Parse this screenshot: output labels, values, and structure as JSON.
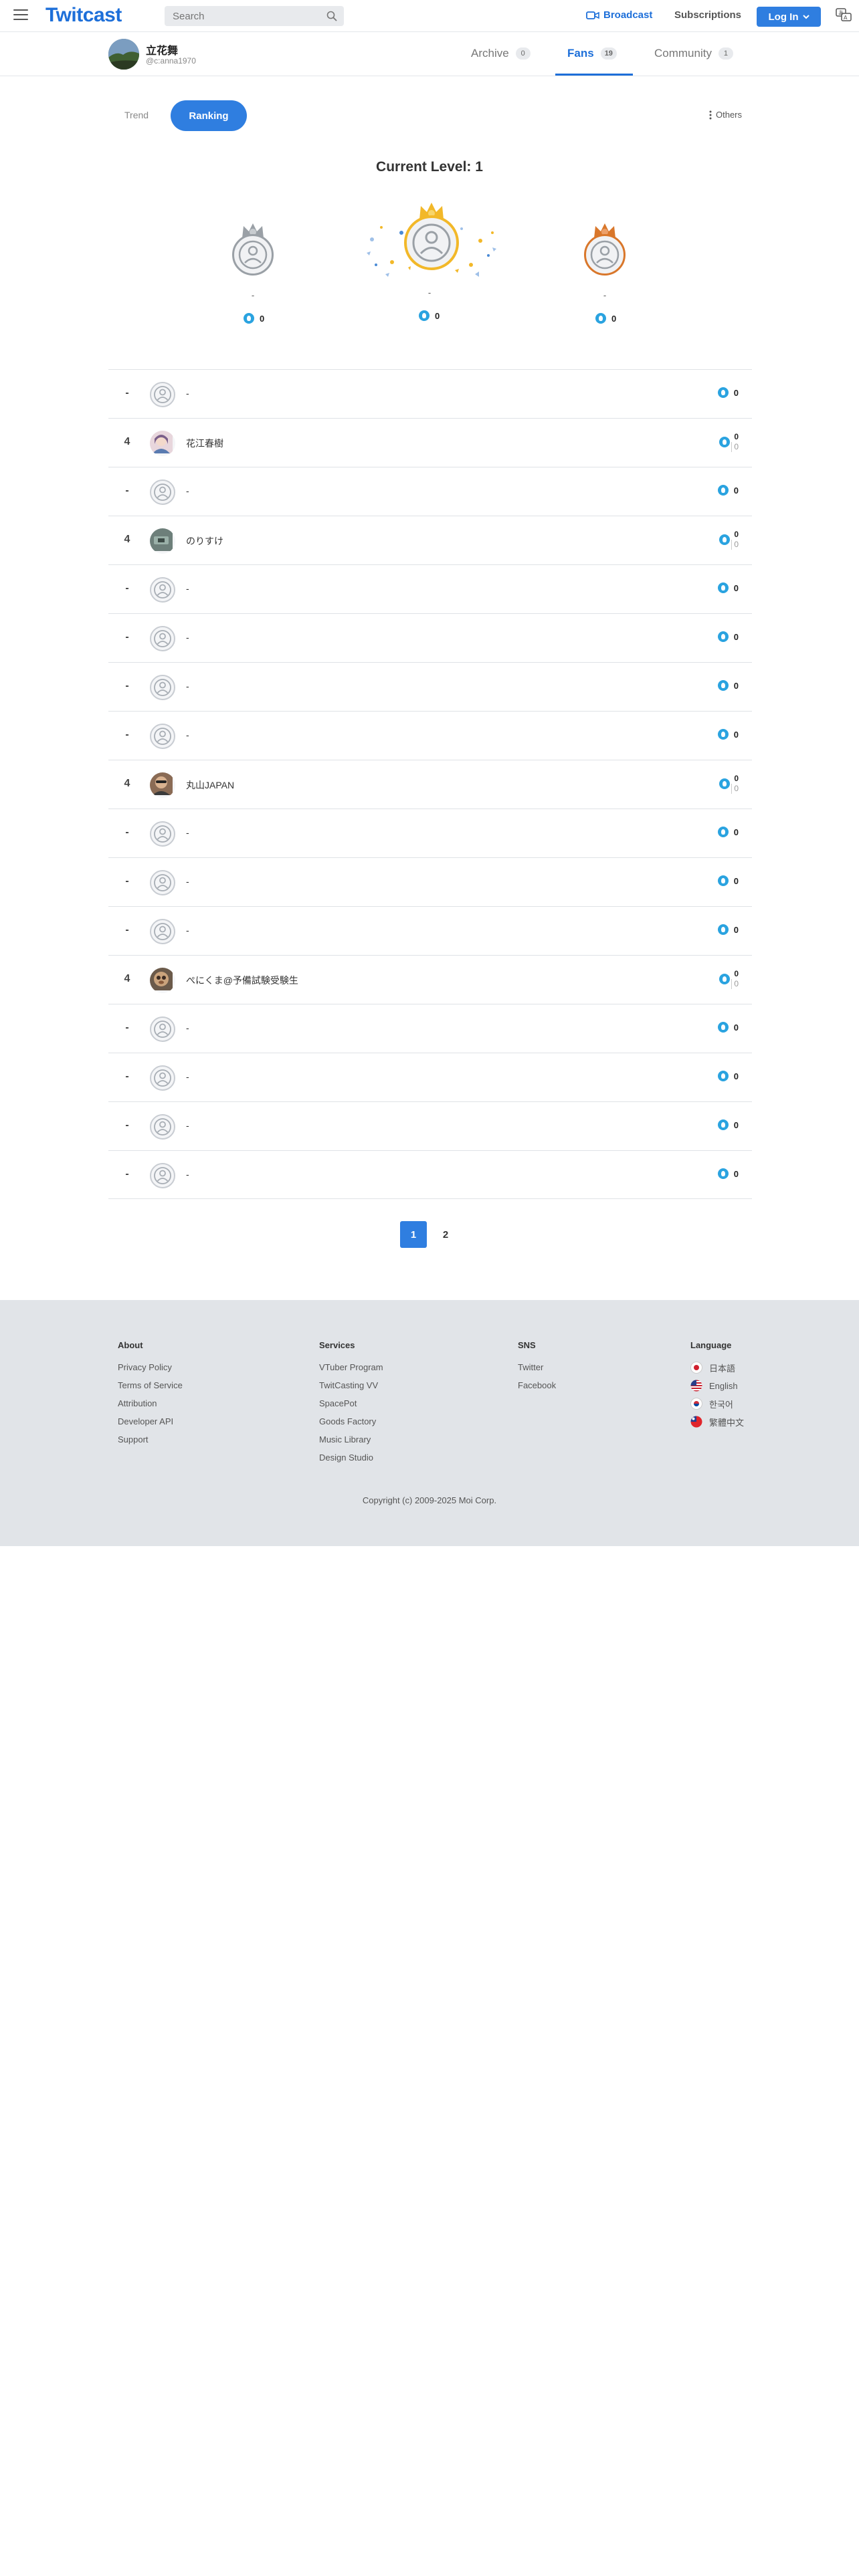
{
  "header": {
    "logo": "Twitcast",
    "search_placeholder": "Search",
    "broadcast": "Broadcast",
    "subscriptions": "Subscriptions",
    "login": "Log In"
  },
  "profile": {
    "name": "立花舞",
    "id": "@c:anna1970",
    "tabs": [
      {
        "label": "Archive",
        "count": "0"
      },
      {
        "label": "Fans",
        "count": "19"
      },
      {
        "label": "Community",
        "count": "1"
      }
    ]
  },
  "subnav": {
    "trend": "Trend",
    "ranking": "Ranking",
    "others": "Others"
  },
  "level": "Current Level: 1",
  "podium": {
    "second": {
      "rank": "2",
      "name": "-",
      "points": "0"
    },
    "first": {
      "rank": "1",
      "name": "-",
      "points": "0"
    },
    "third": {
      "rank": "3",
      "name": "-",
      "points": "0"
    }
  },
  "rows": [
    {
      "rank": "-",
      "name": "-",
      "points": "0"
    },
    {
      "rank": "4",
      "name": "花江春樹",
      "points": "0",
      "sub": "0"
    },
    {
      "rank": "-",
      "name": "-",
      "points": "0"
    },
    {
      "rank": "4",
      "name": "のりすけ",
      "points": "0",
      "sub": "0"
    },
    {
      "rank": "-",
      "name": "-",
      "points": "0"
    },
    {
      "rank": "-",
      "name": "-",
      "points": "0"
    },
    {
      "rank": "-",
      "name": "-",
      "points": "0"
    },
    {
      "rank": "-",
      "name": "-",
      "points": "0"
    },
    {
      "rank": "4",
      "name": "丸山JAPAN",
      "points": "0",
      "sub": "0"
    },
    {
      "rank": "-",
      "name": "-",
      "points": "0"
    },
    {
      "rank": "-",
      "name": "-",
      "points": "0"
    },
    {
      "rank": "-",
      "name": "-",
      "points": "0"
    },
    {
      "rank": "4",
      "name": "ぺにくま@予備試験受験生",
      "points": "0",
      "sub": "0"
    },
    {
      "rank": "-",
      "name": "-",
      "points": "0"
    },
    {
      "rank": "-",
      "name": "-",
      "points": "0"
    },
    {
      "rank": "-",
      "name": "-",
      "points": "0"
    },
    {
      "rank": "-",
      "name": "-",
      "points": "0"
    }
  ],
  "pagination": [
    "1",
    "2"
  ],
  "footer": {
    "about": {
      "title": "About",
      "links": [
        "Privacy Policy",
        "Terms of Service",
        "Attribution",
        "Developer API",
        "Support"
      ]
    },
    "services": {
      "title": "Services",
      "links": [
        "VTuber Program",
        "TwitCasting VV",
        "SpacePot",
        "Goods Factory",
        "Music Library",
        "Design Studio"
      ]
    },
    "sns": {
      "title": "SNS",
      "links": [
        "Twitter",
        "Facebook"
      ]
    },
    "language": {
      "title": "Language",
      "links": [
        "日本語",
        "English",
        "한국어",
        "繁體中文"
      ]
    },
    "copyright": "Copyright (c) 2009-2025 Moi Corp."
  },
  "colors": {
    "accent": "#2f7ee0",
    "gold": "#f2b829",
    "silver": "#9aa0a6",
    "bronze": "#d9772b",
    "point_badge": "#2aa3e0"
  }
}
